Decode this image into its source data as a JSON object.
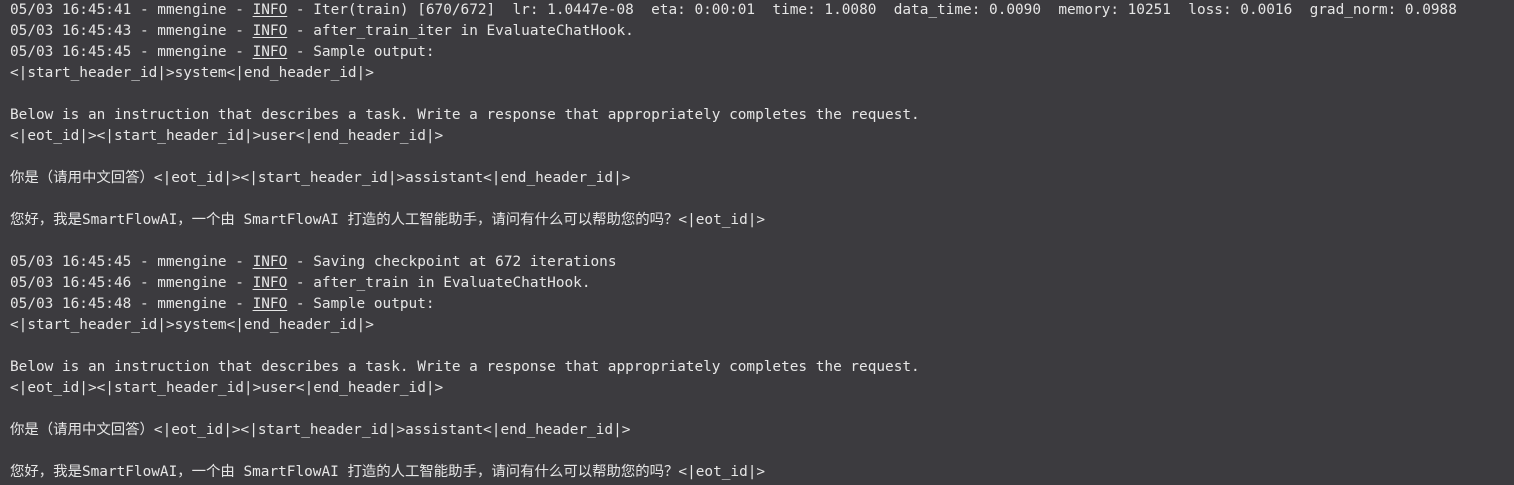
{
  "theme": {
    "background": "#3c3b3f",
    "foreground": "#e6e6e6"
  },
  "terminal": {
    "lines": [
      {
        "type": "log",
        "prefix": "05/03 16:45:41 - mmengine - ",
        "level": "INFO",
        "message": " - Iter(train) [670/672]  lr: 1.0447e-08  eta: 0:00:01  time: 1.0080  data_time: 0.0090  memory: 10251  loss: 0.0016  grad_norm: 0.0988"
      },
      {
        "type": "log",
        "prefix": "05/03 16:45:43 - mmengine - ",
        "level": "INFO",
        "message": " - after_train_iter in EvaluateChatHook."
      },
      {
        "type": "log",
        "prefix": "05/03 16:45:45 - mmengine - ",
        "level": "INFO",
        "message": " - Sample output:"
      },
      {
        "type": "text",
        "text": "<|start_header_id|>system<|end_header_id|>"
      },
      {
        "type": "text",
        "text": ""
      },
      {
        "type": "text",
        "text": "Below is an instruction that describes a task. Write a response that appropriately completes the request."
      },
      {
        "type": "text",
        "text": "<|eot_id|><|start_header_id|>user<|end_header_id|>"
      },
      {
        "type": "text",
        "text": ""
      },
      {
        "type": "text",
        "text": "你是（请用中文回答）<|eot_id|><|start_header_id|>assistant<|end_header_id|>"
      },
      {
        "type": "text",
        "text": ""
      },
      {
        "type": "text",
        "text": "您好，我是SmartFlowAI，一个由 SmartFlowAI 打造的人工智能助手，请问有什么可以帮助您的吗？<|eot_id|>"
      },
      {
        "type": "text",
        "text": ""
      },
      {
        "type": "log",
        "prefix": "05/03 16:45:45 - mmengine - ",
        "level": "INFO",
        "message": " - Saving checkpoint at 672 iterations"
      },
      {
        "type": "log",
        "prefix": "05/03 16:45:46 - mmengine - ",
        "level": "INFO",
        "message": " - after_train in EvaluateChatHook."
      },
      {
        "type": "log",
        "prefix": "05/03 16:45:48 - mmengine - ",
        "level": "INFO",
        "message": " - Sample output:"
      },
      {
        "type": "text",
        "text": "<|start_header_id|>system<|end_header_id|>"
      },
      {
        "type": "text",
        "text": ""
      },
      {
        "type": "text",
        "text": "Below is an instruction that describes a task. Write a response that appropriately completes the request."
      },
      {
        "type": "text",
        "text": "<|eot_id|><|start_header_id|>user<|end_header_id|>"
      },
      {
        "type": "text",
        "text": ""
      },
      {
        "type": "text",
        "text": "你是（请用中文回答）<|eot_id|><|start_header_id|>assistant<|end_header_id|>"
      },
      {
        "type": "text",
        "text": ""
      },
      {
        "type": "text",
        "text": "您好，我是SmartFlowAI，一个由 SmartFlowAI 打造的人工智能助手，请问有什么可以帮助您的吗？<|eot_id|>"
      }
    ]
  }
}
